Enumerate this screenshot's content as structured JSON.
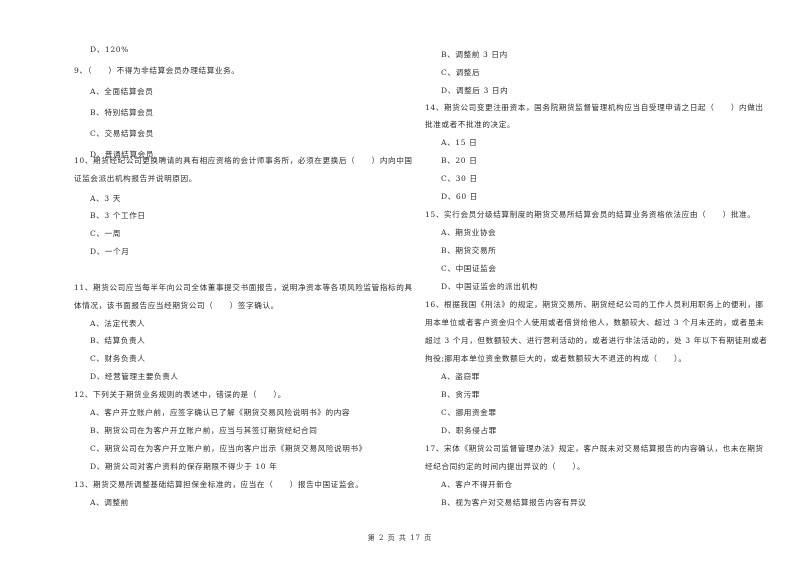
{
  "left_column": {
    "q8_tail": {
      "option_d": "D、120%"
    },
    "q9": {
      "stem": "9、（　　）不得为非结算会员办理结算业务。",
      "options": [
        "A、全面结算会员",
        "B、特别结算会员",
        "C、交易结算会员",
        "D、普通结算会员"
      ]
    },
    "q10": {
      "stem_line1": "10、期货经纪公司更换聘请的具有相应资格的会计师事务所，必须在更换后（　　）内向中国",
      "stem_line2": "证监会派出机构报告并说明原因。",
      "options": [
        "A、3 天",
        "B、3 个工作日",
        "C、一周",
        "D、一个月"
      ]
    },
    "q11": {
      "stem_line1": "11、期货公司应当每半年向公司全体董事提交书面报告，说明净资本等各项风险监管指标的具",
      "stem_line2": "体情况，该书面报告应当经期货公司（　　）签字确认。",
      "options": [
        "A、法定代表人",
        "B、结算负责人",
        "C、财务负责人",
        "D、经营管理主要负责人"
      ]
    },
    "q12": {
      "stem": "12、下列关于期货业务规则的表述中，错误的是（　　）。",
      "options": [
        "A、客户开立账户前，应签字确认已了解《期货交易风险说明书》的内容",
        "B、期货公司在为客户开立账户前，应当与其签订期货经纪合同",
        "C、期货公司在为客户开立账户前，应当向客户出示《期货交易风险说明书》",
        "D、期货公司对客户资料的保存期限不得少于 10 年"
      ]
    },
    "q13": {
      "stem": "13、期货交易所调整基础结算担保金标准的，应当在（　　）报告中国证监会。",
      "options": [
        "A、调整前"
      ]
    }
  },
  "right_column": {
    "q13_cont": {
      "options": [
        "B、调整前 3 日内",
        "C、调整后",
        "D、调整后 3 日内"
      ]
    },
    "q14": {
      "stem_line1": "14、期货公司变更注册资本，国务院期货监督管理机构应当自受理申请之日起（　　）内做出",
      "stem_line2": "批准或者不批准的决定。",
      "options": [
        "A、15 日",
        "B、20 日",
        "C、30 日",
        "D、60 日"
      ]
    },
    "q15": {
      "stem": "15、实行会员分级结算制度的期货交易所结算会员的结算业务资格依法应由（　　）批准。",
      "options": [
        "A、期货业协会",
        "B、期货交易所",
        "C、中国证监会",
        "D、中国证监会的派出机构"
      ]
    },
    "q16": {
      "stem_line1": "16、根据我国《刑法》的规定，期货交易所、期货经纪公司的工作人员利用职务上的便利，挪",
      "stem_line2": "用本单位或者客户资金归个人使用或者借贷给他人，数额较大、超过 3 个月未还的，或者虽未",
      "stem_line3": "超过 3 个月，但数额较大、进行营利活动的，或者进行非法活动的，处 3 年以下有期徒刑或者",
      "stem_line4": "拘役;挪用本单位资金数额巨大的，或者数额较大不退还的构成（　　）。",
      "options": [
        "A、盗窃罪",
        "B、贪污罪",
        "C、挪用资金罪",
        "D、职务侵占罪"
      ]
    },
    "q17": {
      "stem_line1": "17、宋体《期货公司监督管理办法》规定，客户既未对交易结算报告的内容确认，也未在期货",
      "stem_line2": "经纪合同约定的时间内提出异议的（　　）。",
      "options": [
        "A、客户不得开新仓",
        "B、视为客户对交易结算报告内容有异议"
      ]
    }
  },
  "footer": {
    "page_indicator": "第 2 页 共 17 页"
  }
}
